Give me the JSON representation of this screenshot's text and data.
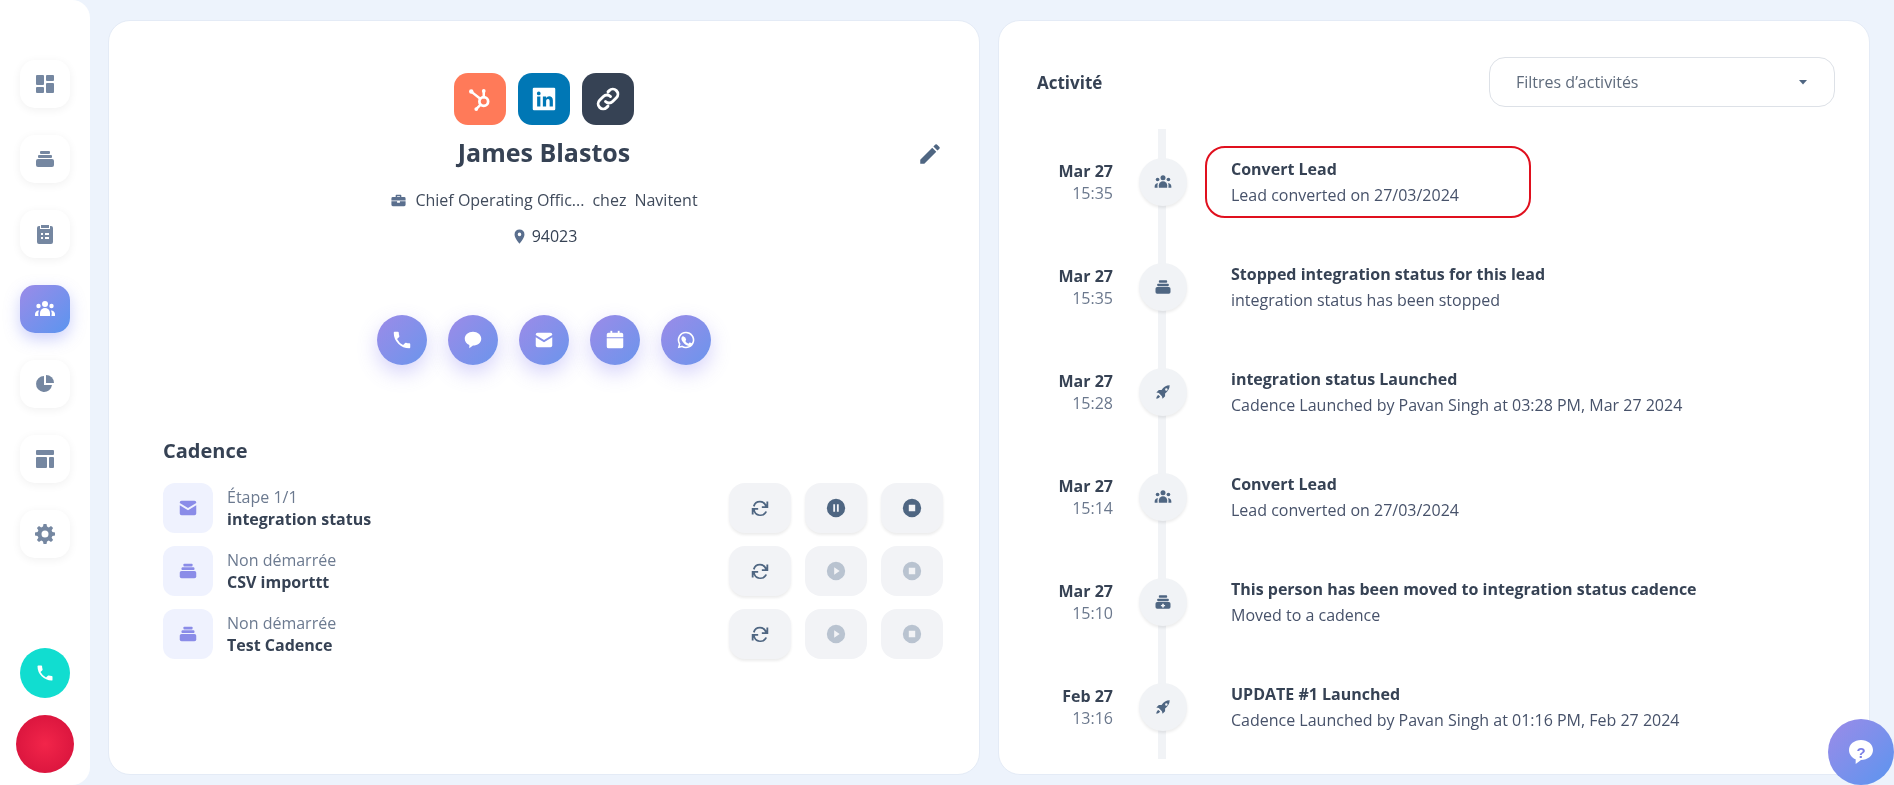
{
  "sidebar": {
    "items": [
      {
        "kind": "dashboard",
        "selected": false
      },
      {
        "kind": "stack",
        "selected": false
      },
      {
        "kind": "clipboard",
        "selected": false
      },
      {
        "kind": "people",
        "selected": true
      },
      {
        "kind": "pie",
        "selected": false
      },
      {
        "kind": "layout",
        "selected": false
      },
      {
        "kind": "gear",
        "selected": false
      }
    ]
  },
  "profile": {
    "links": [
      {
        "kind": "hubspot",
        "color": "#ff7a59"
      },
      {
        "kind": "linkedin",
        "color": "#0077b5"
      },
      {
        "kind": "link",
        "color": "#364254"
      }
    ],
    "name": "James Blastos",
    "job_title": "Chief Operating Offic...",
    "company_prefix": "chez",
    "company": "Navitent",
    "location": "94023",
    "actions": [
      {
        "kind": "phone"
      },
      {
        "kind": "chat"
      },
      {
        "kind": "mail"
      },
      {
        "kind": "calendar"
      },
      {
        "kind": "whatsapp"
      }
    ]
  },
  "cadence": {
    "title": "Cadence",
    "rows": [
      {
        "kind": "mail",
        "status": "Étape 1/1",
        "name": "integration status",
        "controls": [
          {
            "kind": "refresh",
            "disabled": false
          },
          {
            "kind": "pause",
            "disabled": false
          },
          {
            "kind": "stop",
            "disabled": false
          }
        ]
      },
      {
        "kind": "stack",
        "status": "Non démarrée",
        "name": "CSV importtt",
        "controls": [
          {
            "kind": "refresh",
            "disabled": false
          },
          {
            "kind": "play",
            "disabled": true
          },
          {
            "kind": "stop",
            "disabled": true
          }
        ]
      },
      {
        "kind": "stack",
        "status": "Non démarrée",
        "name": "Test Cadence",
        "controls": [
          {
            "kind": "refresh",
            "disabled": false
          },
          {
            "kind": "play",
            "disabled": true
          },
          {
            "kind": "stop",
            "disabled": true
          }
        ]
      }
    ]
  },
  "activity": {
    "title": "Activité",
    "filter": {
      "placeholder": "Filtres d’activités"
    },
    "items": [
      {
        "date": "Mar 27",
        "time": "15:35",
        "kind": "people",
        "title": "Convert Lead",
        "detail": "Lead converted on 27/03/2024",
        "highlighted": true
      },
      {
        "date": "Mar 27",
        "time": "15:35",
        "kind": "stack",
        "title": "Stopped integration status for this lead",
        "detail": "integration status has been stopped",
        "highlighted": false
      },
      {
        "date": "Mar 27",
        "time": "15:28",
        "kind": "rocket",
        "title": "integration status Launched",
        "detail": "Cadence Launched by Pavan Singh at 03:28 PM, Mar 27 2024",
        "highlighted": false
      },
      {
        "date": "Mar 27",
        "time": "15:14",
        "kind": "people",
        "title": "Convert Lead",
        "detail": "Lead converted on 27/03/2024",
        "highlighted": false
      },
      {
        "date": "Mar 27",
        "time": "15:10",
        "kind": "stack-add",
        "title": "This person has been moved to integration status cadence",
        "detail": "Moved to a cadence",
        "highlighted": false
      },
      {
        "date": "Feb 27",
        "time": "13:16",
        "kind": "rocket",
        "title": "UPDATE #1 Launched",
        "detail": "Cadence Launched by Pavan Singh at 01:16 PM, Feb 27 2024",
        "highlighted": false
      }
    ]
  },
  "help": {
    "label": "?"
  }
}
